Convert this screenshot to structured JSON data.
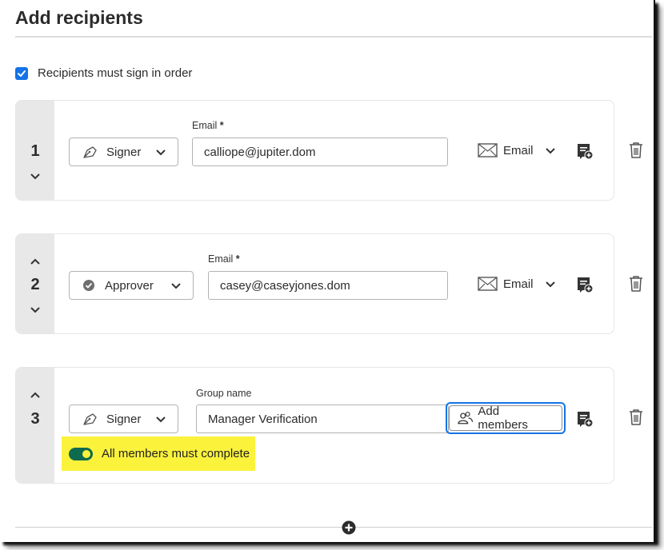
{
  "header": {
    "title": "Add recipients"
  },
  "order": {
    "label": "Recipients must sign in order",
    "checked": true
  },
  "recipients": [
    {
      "number": "1",
      "role": "Signer",
      "role_icon": "pen-nib-icon",
      "field_label": "Email",
      "required_mark": "*",
      "field_value": "calliope@jupiter.dom",
      "delivery_label": "Email",
      "has_up": false,
      "has_down": true
    },
    {
      "number": "2",
      "role": "Approver",
      "role_icon": "check-circle-icon",
      "field_label": "Email",
      "required_mark": "*",
      "field_value": "casey@caseyjones.dom",
      "delivery_label": "Email",
      "has_up": true,
      "has_down": true
    },
    {
      "number": "3",
      "role": "Signer",
      "role_icon": "pen-nib-icon",
      "field_label": "Group name",
      "field_value": "Manager Verification",
      "add_members_label": "Add members",
      "toggle_label": "All members must complete",
      "toggle_on": true,
      "has_up": true,
      "has_down": false
    }
  ],
  "colors": {
    "accent": "#1473e6",
    "toggle": "#0f6b4d",
    "highlight": "#fbf23c"
  }
}
